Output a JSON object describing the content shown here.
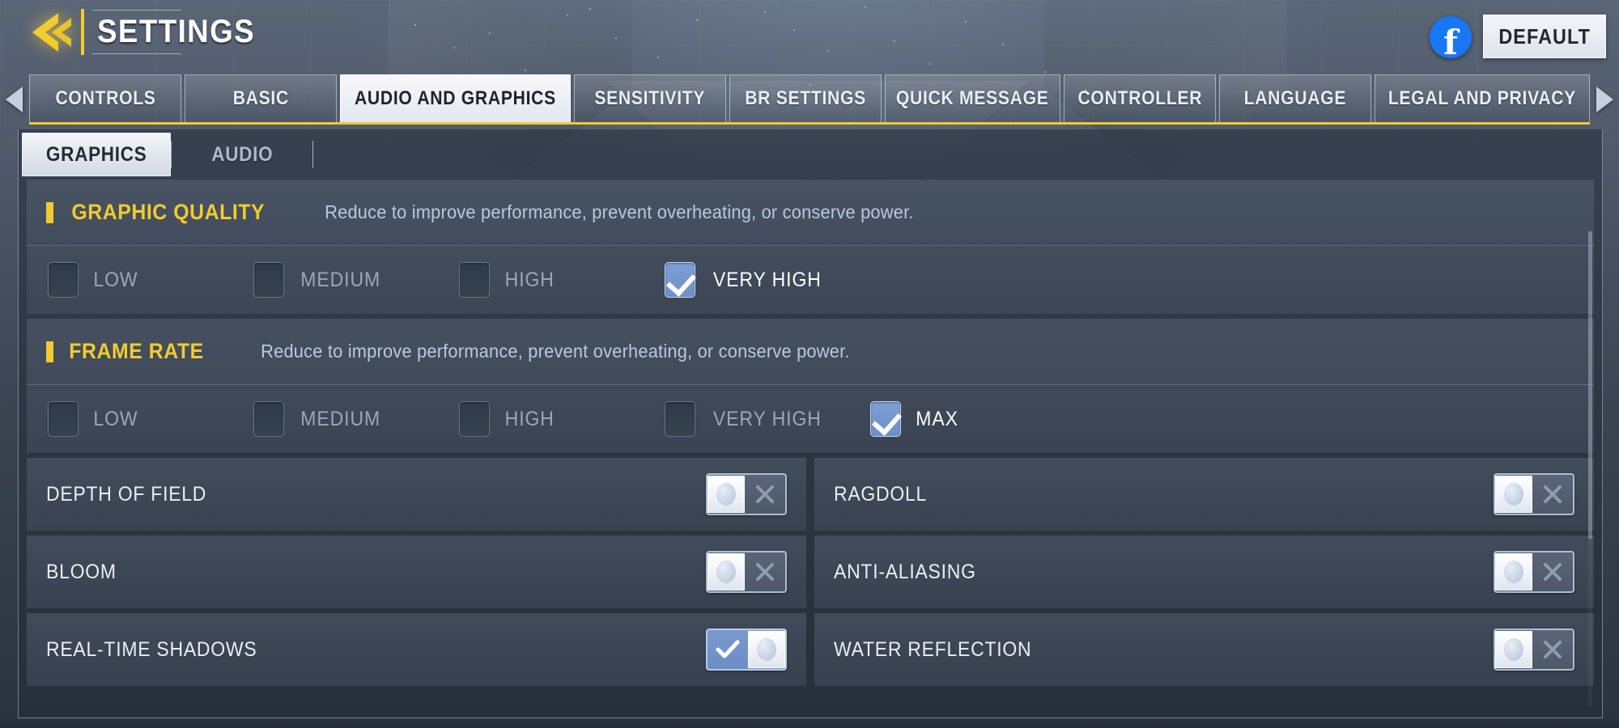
{
  "header": {
    "back_icon": "back-arrow-icon",
    "title": "SETTINGS",
    "facebook_icon": "facebook-icon",
    "facebook_glyph": "f",
    "default_button": "DEFAULT"
  },
  "tabbar": {
    "prev_icon": "chevron-left-icon",
    "next_icon": "chevron-right-icon",
    "accent_color": "#f2cb2e",
    "tabs": [
      {
        "label": "CONTROLS",
        "active": false
      },
      {
        "label": "BASIC",
        "active": false
      },
      {
        "label": "AUDIO AND GRAPHICS",
        "active": true
      },
      {
        "label": "SENSITIVITY",
        "active": false
      },
      {
        "label": "BR SETTINGS",
        "active": false
      },
      {
        "label": "QUICK MESSAGE",
        "active": false
      },
      {
        "label": "CONTROLLER",
        "active": false
      },
      {
        "label": "LANGUAGE",
        "active": false
      },
      {
        "label": "LEGAL AND PRIVACY",
        "active": false
      }
    ]
  },
  "subtabs": [
    {
      "label": "GRAPHICS",
      "active": true
    },
    {
      "label": "AUDIO",
      "active": false
    }
  ],
  "groups": [
    {
      "title": "GRAPHIC QUALITY",
      "description": "Reduce to improve performance, prevent overheating, or conserve power.",
      "options": [
        {
          "label": "LOW",
          "checked": false
        },
        {
          "label": "MEDIUM",
          "checked": false
        },
        {
          "label": "HIGH",
          "checked": false
        },
        {
          "label": "VERY HIGH",
          "checked": true
        }
      ]
    },
    {
      "title": "FRAME RATE",
      "description": "Reduce to improve performance, prevent overheating, or conserve power.",
      "options": [
        {
          "label": "LOW",
          "checked": false
        },
        {
          "label": "MEDIUM",
          "checked": false
        },
        {
          "label": "HIGH",
          "checked": false
        },
        {
          "label": "VERY HIGH",
          "checked": false
        },
        {
          "label": "MAX",
          "checked": true
        }
      ]
    }
  ],
  "toggles": [
    {
      "label": "DEPTH OF FIELD",
      "on": false
    },
    {
      "label": "RAGDOLL",
      "on": false
    },
    {
      "label": "BLOOM",
      "on": false
    },
    {
      "label": "ANTI-ALIASING",
      "on": false
    },
    {
      "label": "REAL-TIME SHADOWS",
      "on": true
    },
    {
      "label": "WATER REFLECTION",
      "on": false
    }
  ]
}
